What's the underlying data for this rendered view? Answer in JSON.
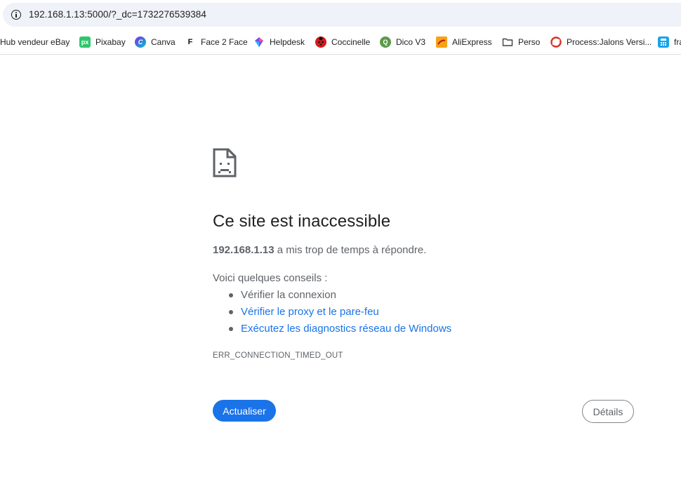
{
  "omnibox": {
    "url": "192.168.1.13:5000/?_dc=1732276539384",
    "icon": "info-icon"
  },
  "bookmarks": [
    {
      "label": "Hub vendeur eBay",
      "icon": "",
      "favicon": ""
    },
    {
      "label": "Pixabay",
      "icon": "pixabay-icon",
      "favicon": "px"
    },
    {
      "label": "Canva",
      "icon": "canva-icon",
      "favicon": "C"
    },
    {
      "label": "Face 2 Face",
      "icon": "face2face-icon",
      "favicon": "F"
    },
    {
      "label": "Helpdesk",
      "icon": "helpdesk-icon",
      "favicon": ""
    },
    {
      "label": "Coccinelle",
      "icon": "ladybug-icon",
      "favicon": ""
    },
    {
      "label": "Dico V3",
      "icon": "dico-icon",
      "favicon": "Q"
    },
    {
      "label": "AliExpress",
      "icon": "aliexpress-icon",
      "favicon": ""
    },
    {
      "label": "Perso",
      "icon": "folder-icon",
      "favicon": ""
    },
    {
      "label": "Process:Jalons Versi...",
      "icon": "process-icon",
      "favicon": ""
    },
    {
      "label": "fra",
      "icon": "calculator-icon",
      "favicon": ""
    }
  ],
  "error": {
    "icon": "sad-page-icon",
    "title": "Ce site est inaccessible",
    "host": "192.168.1.13",
    "message": " a mis trop de temps à répondre.",
    "suggestions_heading": "Voici quelques conseils :",
    "suggestions": [
      {
        "text": "Vérifier la connexion",
        "link": false
      },
      {
        "text": "Vérifier le proxy et le pare-feu",
        "link": true
      },
      {
        "text": "Exécutez les diagnostics réseau de Windows",
        "link": true
      }
    ],
    "code": "ERR_CONNECTION_TIMED_OUT"
  },
  "buttons": {
    "reload": "Actualiser",
    "details": "Détails"
  },
  "colors": {
    "accent": "#1a73e8",
    "text_secondary": "#5f6368",
    "omnibox_bg": "#eff2f8"
  }
}
